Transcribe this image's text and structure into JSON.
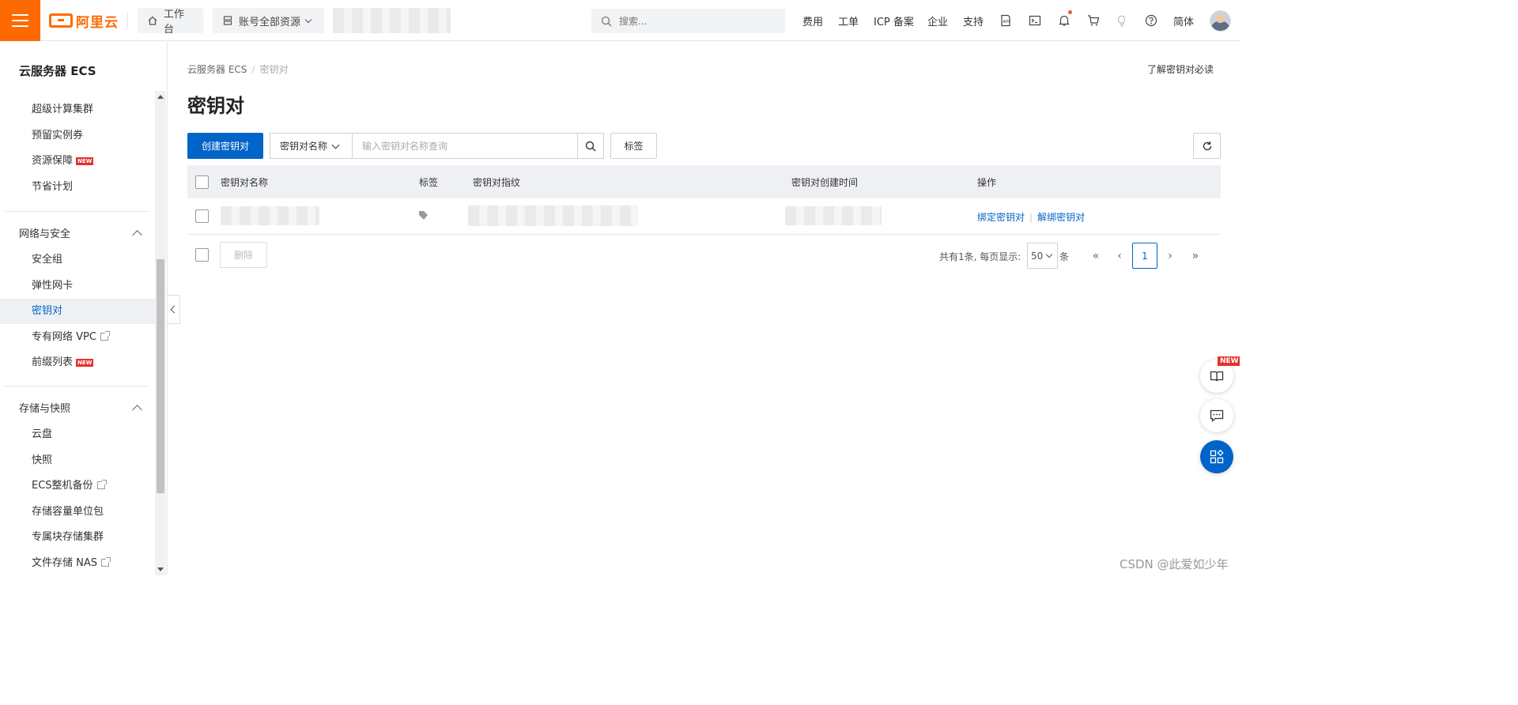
{
  "topbar": {
    "logo_text": "阿里云",
    "workbench_label": "工作台",
    "resources_label": "账号全部资源",
    "search_placeholder": "搜索...",
    "nav_links": [
      "费用",
      "工单",
      "ICP 备案",
      "企业",
      "支持"
    ],
    "language": "简体",
    "accent_color": "#ff6a00"
  },
  "sidebar": {
    "title": "云服务器 ECS",
    "items_top": [
      {
        "label": "超级计算集群"
      },
      {
        "label": "预留实例券"
      },
      {
        "label": "资源保障",
        "badge": "NEW"
      },
      {
        "label": "节省计划"
      }
    ],
    "group_network": "网络与安全",
    "items_network": [
      {
        "label": "安全组"
      },
      {
        "label": "弹性网卡"
      },
      {
        "label": "密钥对",
        "active": true
      },
      {
        "label": "专有网络 VPC",
        "external": true
      },
      {
        "label": "前缀列表",
        "badge": "NEW"
      }
    ],
    "group_storage": "存储与快照",
    "items_storage": [
      {
        "label": "云盘"
      },
      {
        "label": "快照"
      },
      {
        "label": "ECS整机备份",
        "external": true
      },
      {
        "label": "存储容量单位包"
      },
      {
        "label": "专属块存储集群"
      },
      {
        "label": "文件存储 NAS",
        "external": true
      }
    ]
  },
  "main": {
    "breadcrumb": [
      "云服务器 ECS",
      "密钥对"
    ],
    "help_link": "了解密钥对必读",
    "title": "密钥对",
    "create_button": "创建密钥对",
    "filter_field": "密钥对名称",
    "filter_placeholder": "输入密钥对名称查询",
    "tag_button": "标签",
    "table": {
      "columns": [
        "密钥对名称",
        "标签",
        "密钥对指纹",
        "密钥对创建时间",
        "操作"
      ],
      "rows": [
        {
          "actions": [
            "绑定密钥对",
            "解绑密钥对"
          ]
        }
      ]
    },
    "delete_button": "删除",
    "pagination": {
      "info": "共有1条, 每页显示:",
      "page_size": "50",
      "unit": "条",
      "first": "«",
      "prev": "‹",
      "current": "1",
      "next": "›",
      "last": "»"
    }
  },
  "float_widgets": {
    "new_badge": "NEW"
  },
  "watermark": "CSDN @此爱如少年",
  "primary_color": "#0064c8"
}
